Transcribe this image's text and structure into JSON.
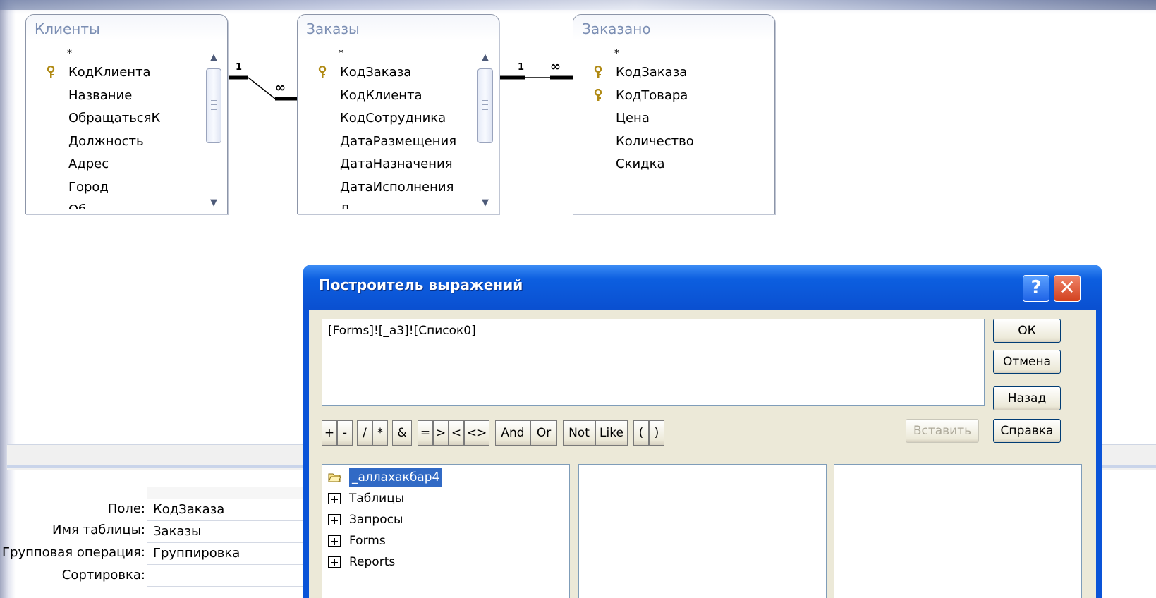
{
  "tables": [
    {
      "title": "Клиенты",
      "fields": [
        {
          "name": "*",
          "key": false
        },
        {
          "name": "КодКлиента",
          "key": true
        },
        {
          "name": "Название",
          "key": false
        },
        {
          "name": "ОбращатьсяК",
          "key": false
        },
        {
          "name": "Должность",
          "key": false
        },
        {
          "name": "Адрес",
          "key": false
        },
        {
          "name": "Город",
          "key": false
        },
        {
          "name": "Об...",
          "key": false
        }
      ]
    },
    {
      "title": "Заказы",
      "fields": [
        {
          "name": "*",
          "key": false
        },
        {
          "name": "КодЗаказа",
          "key": true
        },
        {
          "name": "КодКлиента",
          "key": false
        },
        {
          "name": "КодСотрудника",
          "key": false
        },
        {
          "name": "ДатаРазмещения",
          "key": false
        },
        {
          "name": "ДатаНазначения",
          "key": false
        },
        {
          "name": "ДатаИсполнения",
          "key": false
        },
        {
          "name": "Д...",
          "key": false
        }
      ]
    },
    {
      "title": "Заказано",
      "fields": [
        {
          "name": "*",
          "key": false
        },
        {
          "name": "КодЗаказа",
          "key": true
        },
        {
          "name": "КодТовара",
          "key": true
        },
        {
          "name": "Цена",
          "key": false
        },
        {
          "name": "Количество",
          "key": false
        },
        {
          "name": "Скидка",
          "key": false
        }
      ]
    }
  ],
  "relationships": [
    {
      "one": "1",
      "many": "∞"
    },
    {
      "one": "1",
      "many": "∞"
    }
  ],
  "query_grid": {
    "rows": [
      {
        "label": "Поле:",
        "value": "КодЗаказа"
      },
      {
        "label": "Имя таблицы:",
        "value": "Заказы"
      },
      {
        "label": "Групповая операция:",
        "value": "Группировка"
      },
      {
        "label": "Сортировка:",
        "value": ""
      }
    ]
  },
  "dialog": {
    "title": "Построитель выражений",
    "help_icon": "question-icon",
    "close_icon": "close-icon",
    "expression": "[Forms]![_a3]![Список0]",
    "buttons": {
      "ok": "ОК",
      "cancel": "Отмена",
      "back": "Назад",
      "help": "Справка",
      "insert": "Вставить"
    },
    "operators": [
      "+",
      "-",
      "/",
      "*",
      "&",
      "=",
      ">",
      "<",
      "<>",
      "And",
      "Or",
      "Not",
      "Like",
      "(",
      ")"
    ],
    "tree": [
      {
        "label": "_аллахакбар4",
        "icon": "folder-open-icon",
        "selected": true
      },
      {
        "label": "Таблицы",
        "icon": "expand-plus-icon",
        "selected": false
      },
      {
        "label": "Запросы",
        "icon": "expand-plus-icon",
        "selected": false
      },
      {
        "label": "Forms",
        "icon": "expand-plus-icon",
        "selected": false
      },
      {
        "label": "Reports",
        "icon": "expand-plus-icon",
        "selected": false
      }
    ]
  }
}
